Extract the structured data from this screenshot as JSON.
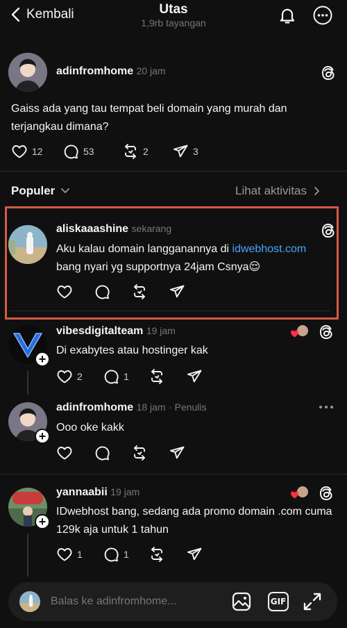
{
  "header": {
    "back_label": "Kembali",
    "title": "Utas",
    "subtitle": "1,9rb tayangan"
  },
  "post": {
    "username": "adinfromhome",
    "time": "20 jam",
    "text": "Gaiss ada yang tau tempat beli domain yang murah dan terjangkau dimana?",
    "likes": "12",
    "comments": "53",
    "reposts": "2",
    "shares": "3"
  },
  "sort": {
    "label": "Populer",
    "activity_label": "Lihat aktivitas"
  },
  "replies": [
    {
      "username": "aliskaaashine",
      "time": "sekarang",
      "text_before": "Aku kalau domain langganannya di ",
      "link": "idwebhost.com",
      "text_after": "bang nyari yg supportnya 24jam Csnya😌"
    },
    {
      "username": "vibesdigitalteam",
      "time": "19 jam",
      "text": "Di exabytes atau hostinger kak",
      "likes": "2",
      "comments": "1"
    },
    {
      "username": "adinfromhome",
      "time": "18 jam",
      "tag": "· Penulis",
      "text": "Ooo oke kakk"
    },
    {
      "username": "yannaabii",
      "time": "19 jam",
      "text": "IDwebhost bang, sedang ada promo  domain .com cuma 129k aja untuk 1 tahun",
      "likes": "1",
      "comments": "1"
    }
  ],
  "reply_bar": {
    "placeholder": "Balas ke adinfromhome...",
    "gif_label": "GIF"
  },
  "colors": {
    "background": "#101010",
    "highlight_border": "#d35b45",
    "link": "#4aa3ff",
    "like_heart": "#ff3040"
  }
}
